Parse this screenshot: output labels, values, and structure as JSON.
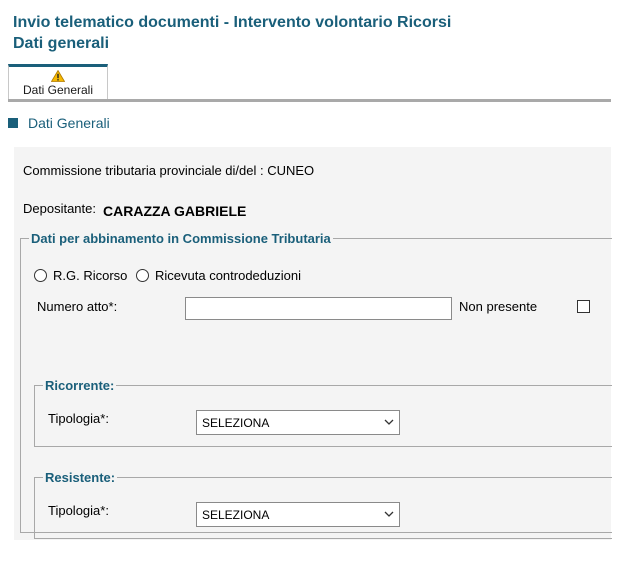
{
  "header": {
    "title_line1": "Invio telematico documenti - Intervento volontario Ricorsi",
    "title_line2": "Dati generali"
  },
  "tabs": [
    {
      "label": "Dati Generali",
      "icon": "warning-icon",
      "active": true
    }
  ],
  "section": {
    "label": "Dati Generali"
  },
  "form": {
    "commissione_text": "Commissione tributaria provinciale di/del : CUNEO",
    "depositante_label": "Depositante:",
    "depositante_value": "CARAZZA GABRIELE",
    "abbinamento": {
      "legend": "Dati per abbinamento in Commissione Tributaria",
      "radio_rg_label": "R.G. Ricorso",
      "radio_ricevuta_label": "Ricevuta controdeduzioni",
      "numero_atto_label": "Numero atto*:",
      "numero_atto_value": "",
      "non_presente_label": "Non presente",
      "non_presente_checked": false,
      "ricorrente": {
        "legend": "Ricorrente:",
        "tipologia_label": "Tipologia*:",
        "tipologia_value": "SELEZIONA"
      },
      "resistente": {
        "legend": "Resistente:",
        "tipologia_label": "Tipologia*:",
        "tipologia_value": "SELEZIONA"
      }
    }
  },
  "colors": {
    "accent": "#1a5f7a",
    "tab_underline": "#a9a9a9",
    "panel_bg": "#f4f4f4",
    "warning": "#f5b800"
  }
}
